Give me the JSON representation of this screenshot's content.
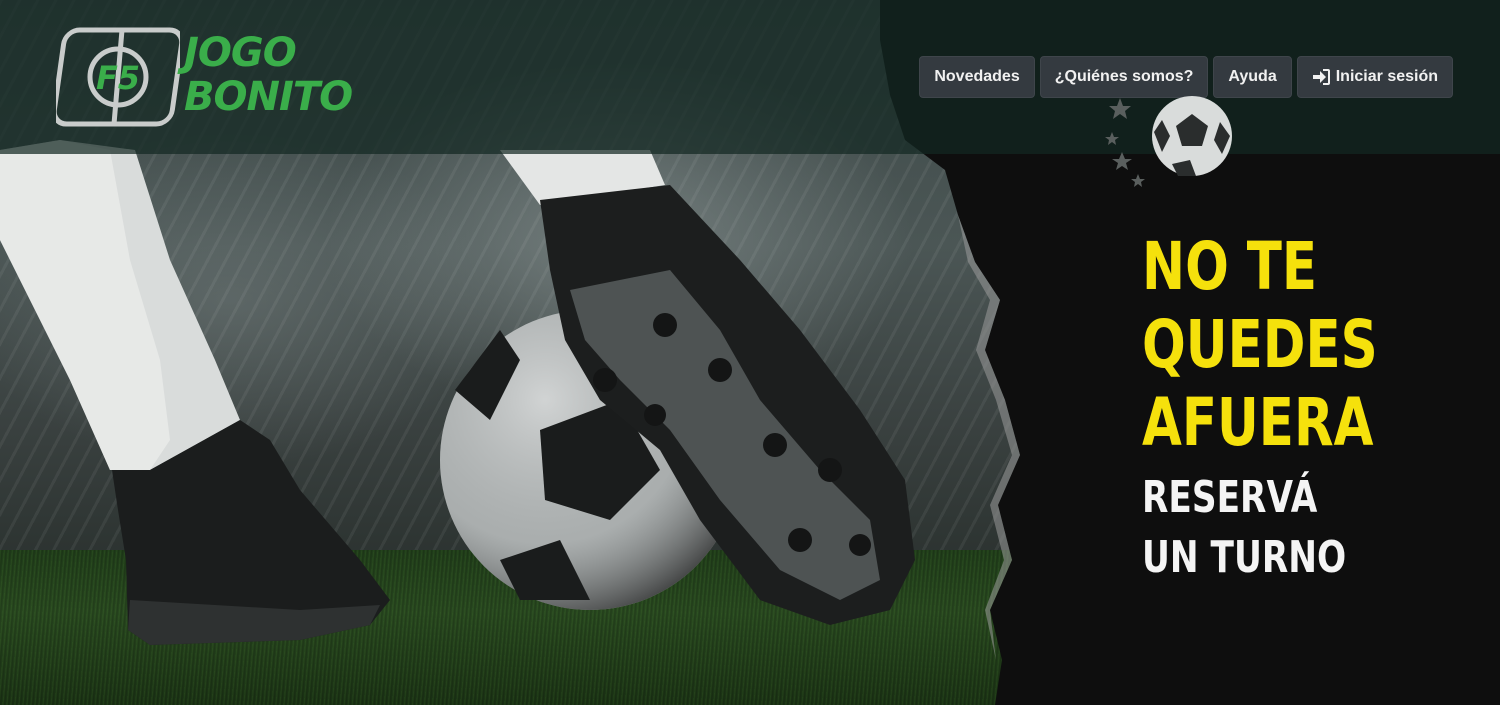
{
  "brand": {
    "logo_badge": "F5",
    "name_line1": "JOGO",
    "name_line2": "BONITO",
    "accent_color": "#3aae4a"
  },
  "nav": {
    "items": [
      {
        "label": "Novedades",
        "icon": ""
      },
      {
        "label": "¿Quiénes somos?",
        "icon": ""
      },
      {
        "label": "Ayuda",
        "icon": ""
      },
      {
        "label": "Iniciar sesión",
        "icon": "sign-in-icon"
      }
    ],
    "button_color": "#343a40"
  },
  "hero": {
    "headline": [
      "NO TE",
      "QUEDES",
      "AFUERA"
    ],
    "subheadline": [
      "RESERVÁ",
      "UN TURNO"
    ],
    "headline_color": "#f5e10c",
    "subheadline_color": "#f4f4f4",
    "background_image": "soccer-cleat-kicking-ball-photo",
    "decoration": "soccer-ball-with-stars-icon"
  }
}
